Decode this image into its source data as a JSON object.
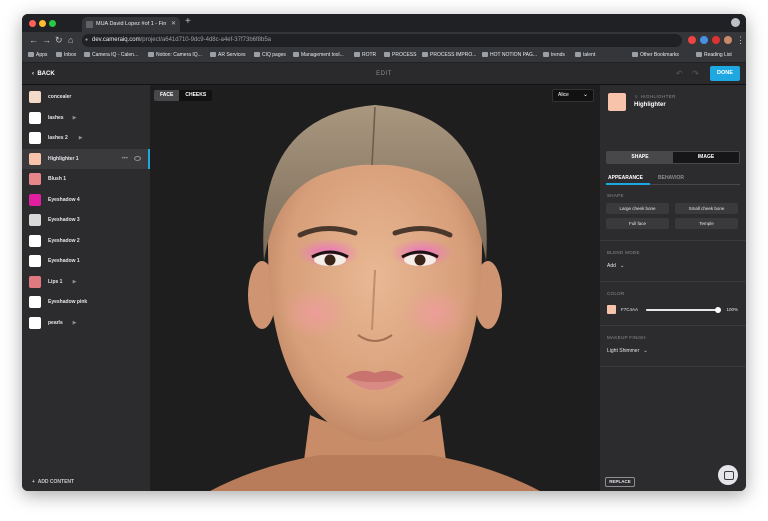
{
  "browser": {
    "tab_title": "MUA David Lopez #of 1 - Fin",
    "url_host": "dev.cameraiq.com",
    "url_path": "/project/a641d710-9dc9-4d8c-a4ef-37f73b6f8b5a",
    "bookmarks": [
      "Apps",
      "Inbox",
      "Camera IQ - Calen...",
      "Notion: Camera IQ...",
      "AR Services",
      "CIQ pages",
      "Management tool...",
      "ROTR",
      "PROCESS",
      "PROCESS IMPRO...",
      "HOT NOTION PAG...",
      "trends",
      "talent",
      "Other Bookmarks",
      "Reading List"
    ]
  },
  "header": {
    "back_label": "BACK",
    "title": "EDIT",
    "done_label": "DONE"
  },
  "layers": [
    {
      "label": "concealer",
      "color": "#f2d9c8",
      "play": false
    },
    {
      "label": "lashes",
      "color": "#ffffff",
      "play": true
    },
    {
      "label": "lashes 2",
      "color": "#ffffff",
      "play": true
    },
    {
      "label": "Highlighter 1",
      "color": "#f7c4ab",
      "play": false,
      "active": true
    },
    {
      "label": "Blush 1",
      "color": "#e8868c",
      "play": false
    },
    {
      "label": "Eyeshadow 4",
      "color": "#e21fa0",
      "play": false
    },
    {
      "label": "Eyeshadow 3",
      "color": "#d9d9d9",
      "play": false
    },
    {
      "label": "Eyeshadow 2",
      "color": "#ffffff",
      "play": false
    },
    {
      "label": "Eyeshadow 1",
      "color": "#ffffff",
      "play": false
    },
    {
      "label": "Lips 1",
      "color": "#e07a80",
      "play": true
    },
    {
      "label": "Eyeshadow pink",
      "color": "#ffffff",
      "play": false
    },
    {
      "label": "pearls",
      "color": "#ffffff",
      "play": true
    }
  ],
  "sidebar": {
    "add_content": "ADD CONTENT"
  },
  "canvas": {
    "tabs": [
      "FACE",
      "CHEEKS"
    ],
    "model": "Alice"
  },
  "panel": {
    "category": "HIGHLIGHTER",
    "name": "Highlighter",
    "mode_tabs": [
      "SHAPE",
      "IMAGE"
    ],
    "sub_tabs": [
      "APPEARANCE",
      "BEHAVIOR"
    ],
    "shape_label": "SHAPE",
    "shape_options": [
      "Large cheek bone",
      "Small cheek bone",
      "Full face",
      "Temple"
    ],
    "blend_label": "BLEND MODE",
    "blend_value": "Add",
    "color_label": "COLOR",
    "color_hex": "F7C4AA",
    "color_value": "#f7c4ab",
    "opacity_pct": 100,
    "opacity_label": "100%",
    "finish_label": "MAKEUP FINISH",
    "finish_value": "Light Shimmer",
    "replace_label": "REPLACE"
  }
}
